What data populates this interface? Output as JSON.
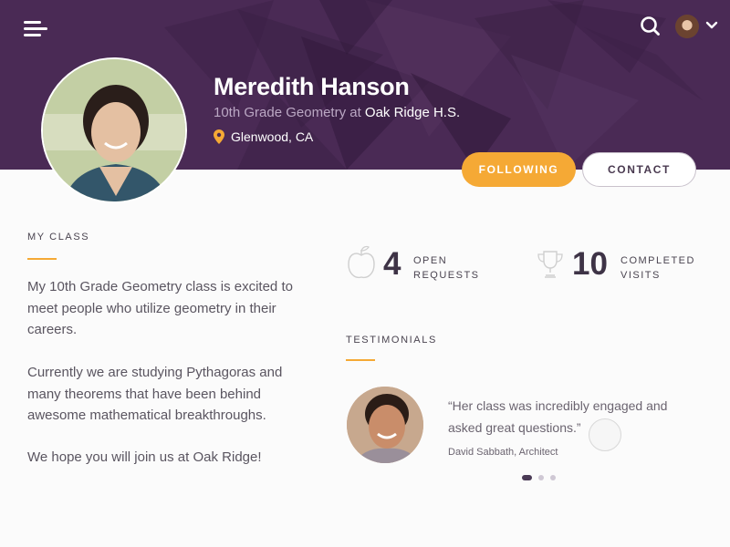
{
  "header": {
    "menu_icon": "hamburger-menu-icon",
    "search_icon": "search-icon",
    "user_menu_icon": "chevron-down-icon",
    "name": "Meredith Hanson",
    "subtitle_prefix": "10th Grade Geometry at",
    "school": "Oak Ridge H.S.",
    "location_icon": "map-pin-icon",
    "location": "Glenwood, CA"
  },
  "actions": {
    "following_label": "FOLLOWING",
    "contact_label": "CONTACT"
  },
  "my_class": {
    "title": "MY CLASS",
    "paragraphs": [
      "My 10th Grade Geometry class is excited to meet people who utilize geometry in their careers.",
      "Currently we are studying Pythagoras and many theorems that have been behind awesome mathematical breakthroughs.",
      "We hope you will join us at Oak Ridge!"
    ]
  },
  "stats": [
    {
      "icon": "apple-icon",
      "value": "4",
      "label_line1": "OPEN",
      "label_line2": "REQUESTS"
    },
    {
      "icon": "trophy-icon",
      "value": "10",
      "label_line1": "COMPLETED",
      "label_line2": "VISITS"
    }
  ],
  "testimonials": {
    "title": "TESTIMONIALS",
    "quote": "“Her class was incredibly engaged and asked great questions.”",
    "author": "David Sabbath, Architect",
    "active_index": 0,
    "count": 3
  },
  "colors": {
    "header_bg": "#4a2a55",
    "accent": "#f5a935",
    "text_dark": "#3e3346"
  }
}
